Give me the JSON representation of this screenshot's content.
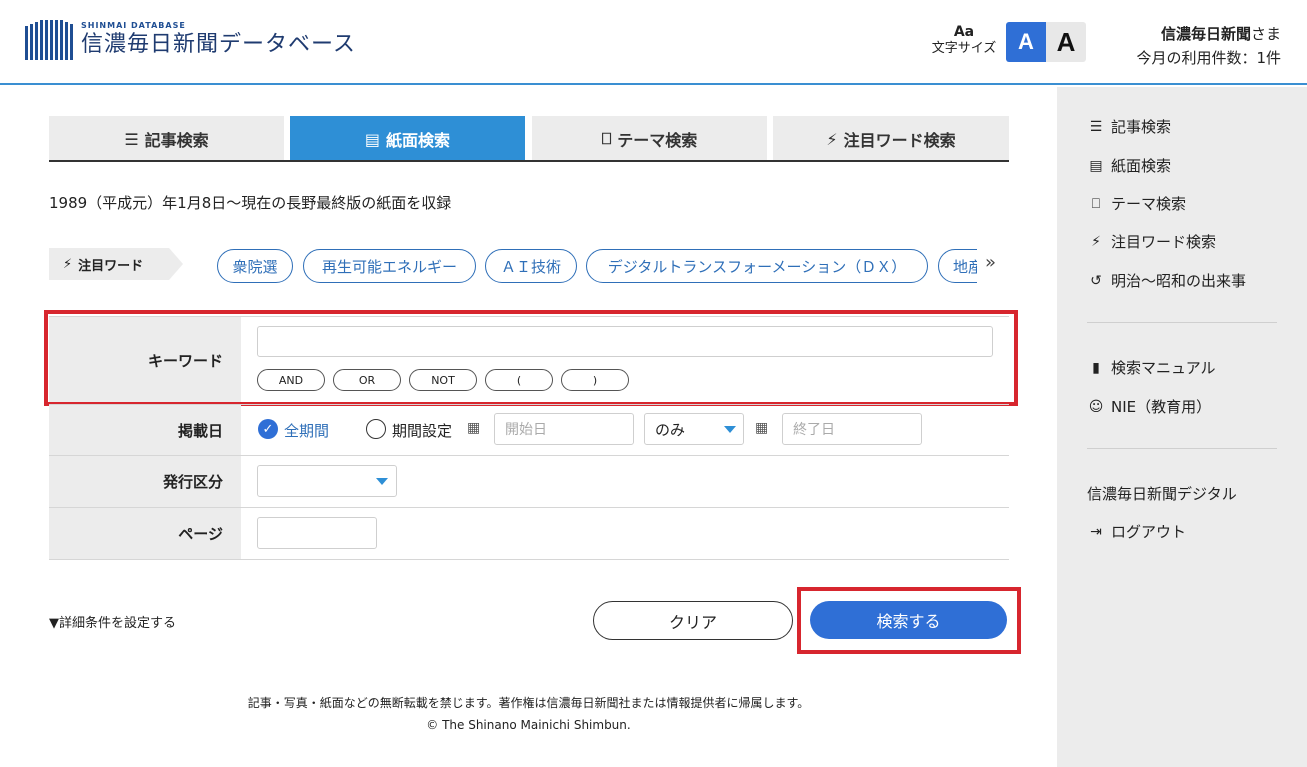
{
  "header": {
    "logo_sub": "SHINMAI DATABASE",
    "logo_main": "信濃毎日新聞データベース",
    "font_size_icon": "Aa",
    "font_size_label": "文字サイズ",
    "font_small": "A",
    "font_large": "A",
    "user_name": "信濃毎日新聞",
    "user_suffix": "さま",
    "usage": "今月の利用件数：1件"
  },
  "tabs": [
    {
      "icon": "☰",
      "label": "記事検索"
    },
    {
      "icon": "▤",
      "label": "紙面検索"
    },
    {
      "icon": "⎕",
      "label": "テーマ検索"
    },
    {
      "icon": "⚡",
      "label": "注目ワード検索"
    }
  ],
  "notice": "1989（平成元）年1月8日～現在の長野最終版の紙面を収録",
  "hotwords": {
    "label": "注目ワード",
    "items": [
      "衆院選",
      "再生可能エネルギー",
      "ＡＩ技術",
      "デジタルトランスフォーメーション（ＤＸ）",
      "地産地消"
    ],
    "more": "»"
  },
  "form": {
    "keyword_label": "キーワード",
    "keyword_value": "",
    "operators": [
      "AND",
      "OR",
      "NOT",
      "(",
      ")"
    ],
    "date_label": "掲載日",
    "all_period": "全期間",
    "set_period": "期間設定",
    "start_placeholder": "開始日",
    "mode_value": "のみ",
    "end_placeholder": "終了日",
    "issue_label": "発行区分",
    "issue_value": "",
    "page_label": "ページ",
    "page_value": ""
  },
  "actions": {
    "detail": "▼詳細条件を設定する",
    "clear": "クリア",
    "search": "検索する"
  },
  "sidebar": {
    "items": [
      {
        "icon": "☰",
        "label": "記事検索"
      },
      {
        "icon": "▤",
        "label": "紙面検索"
      },
      {
        "icon": "⎕",
        "label": "テーマ検索"
      },
      {
        "icon": "⚡",
        "label": "注目ワード検索"
      },
      {
        "icon": "↺",
        "label": "明治～昭和の出来事"
      }
    ],
    "items2": [
      {
        "icon": "▮",
        "label": "検索マニュアル"
      },
      {
        "icon": "☺",
        "label": "NIE（教育用）"
      }
    ],
    "digital": "信濃毎日新聞デジタル",
    "logout_icon": "⇥",
    "logout": "ログアウト"
  },
  "footer": {
    "notice": "記事・写真・紙面などの無断転載を禁じます。著作権は信濃毎日新聞社または情報提供者に帰属します。",
    "copyright": "© The Shinano Mainichi Shimbun."
  },
  "colors": {
    "accent": "#2e8fd6",
    "primary_button": "#2f6fd6",
    "highlight": "#d7262e"
  }
}
